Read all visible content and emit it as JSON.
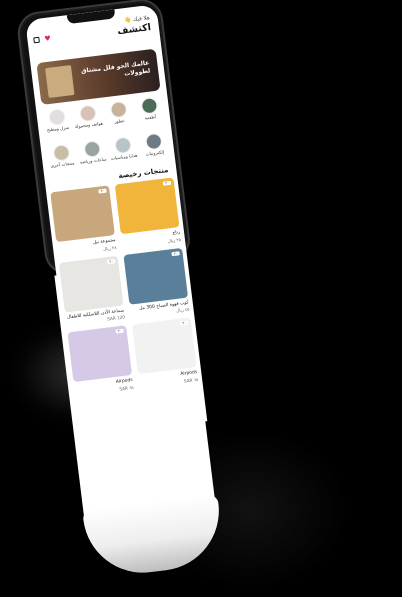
{
  "header": {
    "greeting": "هلا فيك 👋",
    "title": "اكتشف"
  },
  "banner": {
    "text": "عالمك الجو فلل مشتاق لطوولات"
  },
  "categories": [
    {
      "label": "أطعمة",
      "color": "#4b6b58"
    },
    {
      "label": "عطور",
      "color": "#c7b39a"
    },
    {
      "label": "هواتف ومحمولة",
      "color": "#d9c1b7"
    },
    {
      "label": "منزل ومطبخ",
      "color": "#e2dede"
    },
    {
      "label": "إلكترونيات",
      "color": "#6e7a84"
    },
    {
      "label": "هدايا ومناسبات",
      "color": "#b8c4c8"
    },
    {
      "label": "ساعات ورياضة",
      "color": "#9aa49e"
    },
    {
      "label": "منتجات أخرى",
      "color": "#c9bda8"
    }
  ],
  "section_title": "منتجات رخيصة",
  "products": [
    {
      "name": "رتاج",
      "price": "٣٥ ريال",
      "color": "#f0b53a"
    },
    {
      "name": "مجموعة نيل",
      "price": "٢٨ ريال",
      "color": "#c9a77d"
    },
    {
      "name": "كوب قهوة الصباح 300 مل",
      "price": "٤٥ ريال",
      "color": "#5a7f9a"
    },
    {
      "name": "سماعة الأذن اللاسلكية للاطفال",
      "price": "120 SAR",
      "color": "#e7e6e3"
    },
    {
      "name": "Airpods",
      "price": "٦٥ SAR",
      "color": "#f2f2f2"
    },
    {
      "name": "Airpods",
      "price": "٦٥ SAR",
      "color": "#d6c9e8"
    }
  ],
  "tag_label": "٣٠"
}
